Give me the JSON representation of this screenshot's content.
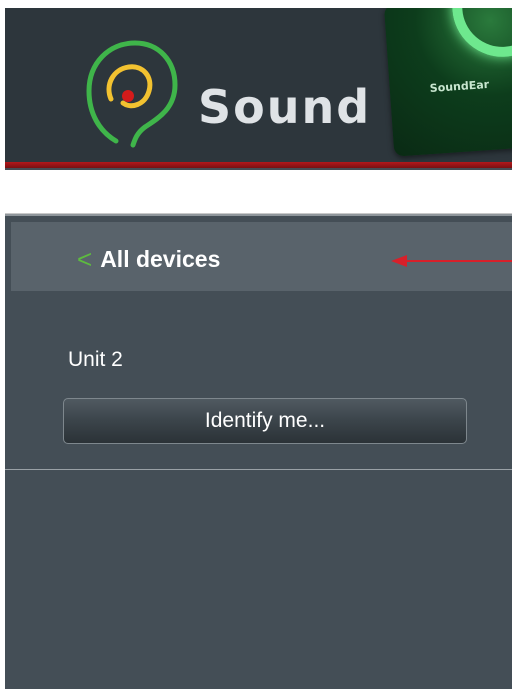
{
  "header": {
    "brand": "Sound",
    "device_label": "SoundEar"
  },
  "nav": {
    "back_chevron": "<",
    "back_label": "All devices"
  },
  "device": {
    "unit_name": "Unit 2",
    "identify_label": "Identify me..."
  },
  "colors": {
    "accent_green": "#5dbb3f",
    "accent_red": "#b3181b",
    "panel_bg": "#444e56"
  }
}
